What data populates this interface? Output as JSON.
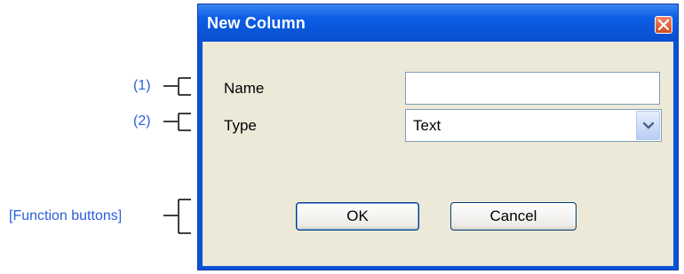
{
  "annotations": {
    "name_marker": "(1)",
    "type_marker": "(2)",
    "buttons_marker": "[Function buttons]"
  },
  "dialog": {
    "title": "New Column",
    "close_icon": "close-icon",
    "fields": {
      "name_label": "Name",
      "name_value": "",
      "type_label": "Type",
      "type_value": "Text"
    },
    "buttons": {
      "ok_label": "OK",
      "cancel_label": "Cancel"
    }
  },
  "colors": {
    "annotation": "#2a5fd8",
    "titlebar": "#0a55d8",
    "client_background": "#ece9d8"
  }
}
